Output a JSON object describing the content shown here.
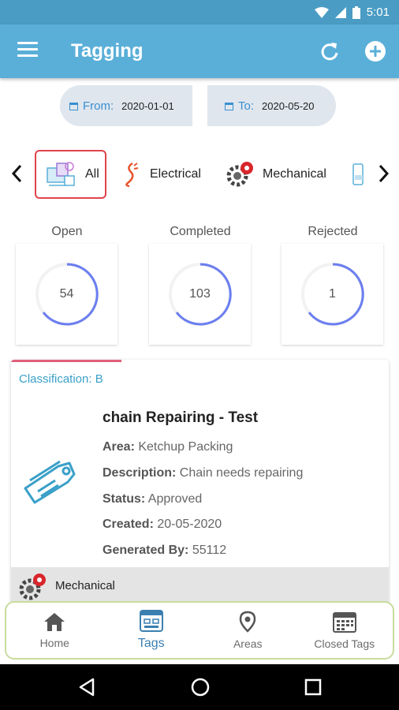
{
  "status_bar": {
    "time": "5:01"
  },
  "app_bar": {
    "title": "Tagging"
  },
  "date_range": {
    "from_label": "From:",
    "from_value": "2020-01-01",
    "to_label": "To:",
    "to_value": "2020-05-20"
  },
  "categories": {
    "selected": "All",
    "items": [
      {
        "label": "All",
        "icon": "all-category-icon"
      },
      {
        "label": "Electrical",
        "icon": "electrical-icon"
      },
      {
        "label": "Mechanical",
        "icon": "mechanical-gear-icon"
      }
    ]
  },
  "stats": [
    {
      "title": "Open",
      "value": "54"
    },
    {
      "title": "Completed",
      "value": "103"
    },
    {
      "title": "Rejected",
      "value": "1"
    }
  ],
  "tag_card": {
    "classification": "Classification: B",
    "title": "chain Repairing - Test",
    "area_label": "Area:",
    "area_value": "Ketchup Packing",
    "description_label": "Description:",
    "description_value": "Chain needs repairing",
    "status_label": "Status:",
    "status_value": "Approved",
    "created_label": "Created:",
    "created_value": "20-05-2020",
    "generated_label": "Generated By:",
    "generated_value": "55112",
    "footer_category": "Mechanical"
  },
  "bottom_nav": {
    "active": "Tags",
    "items": [
      {
        "label": "Home",
        "icon": "home-icon"
      },
      {
        "label": "Tags",
        "icon": "tags-icon"
      },
      {
        "label": "Areas",
        "icon": "location-pin-icon"
      },
      {
        "label": "Closed Tags",
        "icon": "calendar-icon"
      }
    ]
  },
  "colors": {
    "app_bar": "#5aafd8",
    "status_bar": "#4a9cc4",
    "accent_blue": "#3a8fd0",
    "selected_border": "#e0434b",
    "progress_ring": "#6b7ef0",
    "classification": "#3aa0c8"
  }
}
